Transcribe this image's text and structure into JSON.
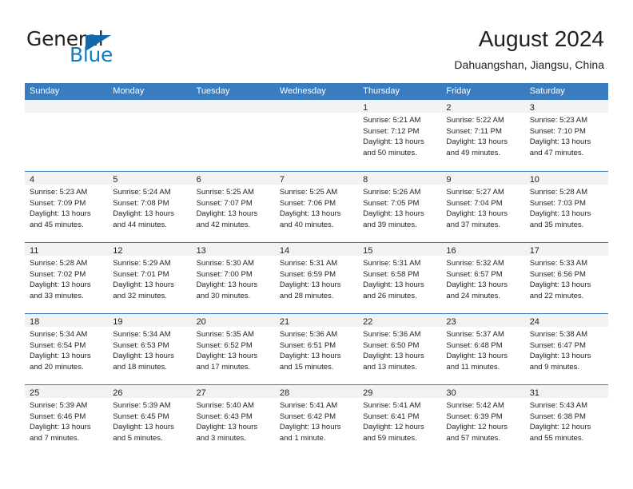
{
  "brand": {
    "name_part1": "General",
    "name_part2": "Blue",
    "accent_color": "#0f7dc2",
    "triangle_color": "#1268ad"
  },
  "header": {
    "title": "August 2024",
    "subtitle": "Dahuangshan, Jiangsu, China"
  },
  "calendar": {
    "header_color": "#3a7cc0",
    "weekdays": [
      "Sunday",
      "Monday",
      "Tuesday",
      "Wednesday",
      "Thursday",
      "Friday",
      "Saturday"
    ],
    "weeks": [
      [
        {
          "day": "",
          "lines": []
        },
        {
          "day": "",
          "lines": []
        },
        {
          "day": "",
          "lines": []
        },
        {
          "day": "",
          "lines": []
        },
        {
          "day": "1",
          "lines": [
            "Sunrise: 5:21 AM",
            "Sunset: 7:12 PM",
            "Daylight: 13 hours",
            "and 50 minutes."
          ]
        },
        {
          "day": "2",
          "lines": [
            "Sunrise: 5:22 AM",
            "Sunset: 7:11 PM",
            "Daylight: 13 hours",
            "and 49 minutes."
          ]
        },
        {
          "day": "3",
          "lines": [
            "Sunrise: 5:23 AM",
            "Sunset: 7:10 PM",
            "Daylight: 13 hours",
            "and 47 minutes."
          ]
        }
      ],
      [
        {
          "day": "4",
          "lines": [
            "Sunrise: 5:23 AM",
            "Sunset: 7:09 PM",
            "Daylight: 13 hours",
            "and 45 minutes."
          ]
        },
        {
          "day": "5",
          "lines": [
            "Sunrise: 5:24 AM",
            "Sunset: 7:08 PM",
            "Daylight: 13 hours",
            "and 44 minutes."
          ]
        },
        {
          "day": "6",
          "lines": [
            "Sunrise: 5:25 AM",
            "Sunset: 7:07 PM",
            "Daylight: 13 hours",
            "and 42 minutes."
          ]
        },
        {
          "day": "7",
          "lines": [
            "Sunrise: 5:25 AM",
            "Sunset: 7:06 PM",
            "Daylight: 13 hours",
            "and 40 minutes."
          ]
        },
        {
          "day": "8",
          "lines": [
            "Sunrise: 5:26 AM",
            "Sunset: 7:05 PM",
            "Daylight: 13 hours",
            "and 39 minutes."
          ]
        },
        {
          "day": "9",
          "lines": [
            "Sunrise: 5:27 AM",
            "Sunset: 7:04 PM",
            "Daylight: 13 hours",
            "and 37 minutes."
          ]
        },
        {
          "day": "10",
          "lines": [
            "Sunrise: 5:28 AM",
            "Sunset: 7:03 PM",
            "Daylight: 13 hours",
            "and 35 minutes."
          ]
        }
      ],
      [
        {
          "day": "11",
          "lines": [
            "Sunrise: 5:28 AM",
            "Sunset: 7:02 PM",
            "Daylight: 13 hours",
            "and 33 minutes."
          ]
        },
        {
          "day": "12",
          "lines": [
            "Sunrise: 5:29 AM",
            "Sunset: 7:01 PM",
            "Daylight: 13 hours",
            "and 32 minutes."
          ]
        },
        {
          "day": "13",
          "lines": [
            "Sunrise: 5:30 AM",
            "Sunset: 7:00 PM",
            "Daylight: 13 hours",
            "and 30 minutes."
          ]
        },
        {
          "day": "14",
          "lines": [
            "Sunrise: 5:31 AM",
            "Sunset: 6:59 PM",
            "Daylight: 13 hours",
            "and 28 minutes."
          ]
        },
        {
          "day": "15",
          "lines": [
            "Sunrise: 5:31 AM",
            "Sunset: 6:58 PM",
            "Daylight: 13 hours",
            "and 26 minutes."
          ]
        },
        {
          "day": "16",
          "lines": [
            "Sunrise: 5:32 AM",
            "Sunset: 6:57 PM",
            "Daylight: 13 hours",
            "and 24 minutes."
          ]
        },
        {
          "day": "17",
          "lines": [
            "Sunrise: 5:33 AM",
            "Sunset: 6:56 PM",
            "Daylight: 13 hours",
            "and 22 minutes."
          ]
        }
      ],
      [
        {
          "day": "18",
          "lines": [
            "Sunrise: 5:34 AM",
            "Sunset: 6:54 PM",
            "Daylight: 13 hours",
            "and 20 minutes."
          ]
        },
        {
          "day": "19",
          "lines": [
            "Sunrise: 5:34 AM",
            "Sunset: 6:53 PM",
            "Daylight: 13 hours",
            "and 18 minutes."
          ]
        },
        {
          "day": "20",
          "lines": [
            "Sunrise: 5:35 AM",
            "Sunset: 6:52 PM",
            "Daylight: 13 hours",
            "and 17 minutes."
          ]
        },
        {
          "day": "21",
          "lines": [
            "Sunrise: 5:36 AM",
            "Sunset: 6:51 PM",
            "Daylight: 13 hours",
            "and 15 minutes."
          ]
        },
        {
          "day": "22",
          "lines": [
            "Sunrise: 5:36 AM",
            "Sunset: 6:50 PM",
            "Daylight: 13 hours",
            "and 13 minutes."
          ]
        },
        {
          "day": "23",
          "lines": [
            "Sunrise: 5:37 AM",
            "Sunset: 6:48 PM",
            "Daylight: 13 hours",
            "and 11 minutes."
          ]
        },
        {
          "day": "24",
          "lines": [
            "Sunrise: 5:38 AM",
            "Sunset: 6:47 PM",
            "Daylight: 13 hours",
            "and 9 minutes."
          ]
        }
      ],
      [
        {
          "day": "25",
          "lines": [
            "Sunrise: 5:39 AM",
            "Sunset: 6:46 PM",
            "Daylight: 13 hours",
            "and 7 minutes."
          ]
        },
        {
          "day": "26",
          "lines": [
            "Sunrise: 5:39 AM",
            "Sunset: 6:45 PM",
            "Daylight: 13 hours",
            "and 5 minutes."
          ]
        },
        {
          "day": "27",
          "lines": [
            "Sunrise: 5:40 AM",
            "Sunset: 6:43 PM",
            "Daylight: 13 hours",
            "and 3 minutes."
          ]
        },
        {
          "day": "28",
          "lines": [
            "Sunrise: 5:41 AM",
            "Sunset: 6:42 PM",
            "Daylight: 13 hours",
            "and 1 minute."
          ]
        },
        {
          "day": "29",
          "lines": [
            "Sunrise: 5:41 AM",
            "Sunset: 6:41 PM",
            "Daylight: 12 hours",
            "and 59 minutes."
          ]
        },
        {
          "day": "30",
          "lines": [
            "Sunrise: 5:42 AM",
            "Sunset: 6:39 PM",
            "Daylight: 12 hours",
            "and 57 minutes."
          ]
        },
        {
          "day": "31",
          "lines": [
            "Sunrise: 5:43 AM",
            "Sunset: 6:38 PM",
            "Daylight: 12 hours",
            "and 55 minutes."
          ]
        }
      ]
    ]
  }
}
